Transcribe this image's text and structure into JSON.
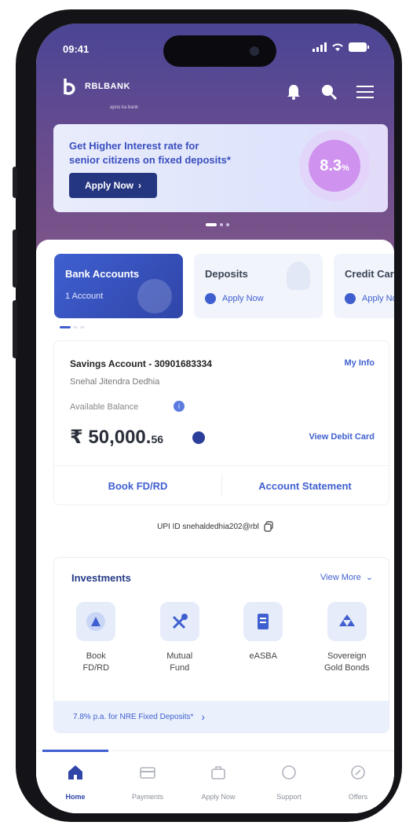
{
  "status_bar": {
    "time": "09:41"
  },
  "header": {
    "brand": "RBLBANK",
    "tagline": "apno ka bank"
  },
  "banner": {
    "line1": "Get Higher Interest rate for",
    "line2": "senior citizens on fixed deposits*",
    "cta": "Apply Now",
    "rate": "8.3",
    "rate_suffix": "%"
  },
  "product_tabs": [
    {
      "title": "Bank Accounts",
      "sub": "1 Account"
    },
    {
      "title": "Deposits",
      "cta": "Apply Now"
    },
    {
      "title": "Credit Card",
      "cta": "Apply Now"
    }
  ],
  "account": {
    "name": "Savings Account - 30901683334",
    "holder": "Snehal Jitendra Dedhia",
    "my_info": "My Info",
    "available_label": "Available Balance",
    "currency": "₹",
    "amount_main": "50,000.",
    "amount_decimal": "56",
    "view_debit": "View Debit Card",
    "book_fd": "Book FD/RD",
    "statement": "Account Statement"
  },
  "upi": {
    "text": "UPI ID snehaldedhia202@rbl"
  },
  "investments": {
    "title": "Investments",
    "view_more": "View More",
    "items": [
      {
        "label": "Book\nFD/RD",
        "icon": "fd-icon"
      },
      {
        "label": "Mutual\nFund",
        "icon": "mutual-fund-icon"
      },
      {
        "label": "eASBA",
        "icon": "easba-icon"
      },
      {
        "label": "Sovereign\nGold Bonds",
        "icon": "gold-bonds-icon"
      }
    ],
    "promo": "7.8% p.a. for NRE Fixed Deposits*"
  },
  "bottom_nav": [
    {
      "label": "Home",
      "icon": "home-icon",
      "active": true
    },
    {
      "label": "Payments",
      "icon": "payments-icon"
    },
    {
      "label": "Apply Now",
      "icon": "apply-icon"
    },
    {
      "label": "Support",
      "icon": "support-icon"
    },
    {
      "label": "Offers",
      "icon": "offers-icon"
    }
  ],
  "colors": {
    "primary": "#3f5fd0",
    "hero_start": "#4a4595",
    "hero_end": "#7d5588",
    "badge": "#cf92ee"
  }
}
